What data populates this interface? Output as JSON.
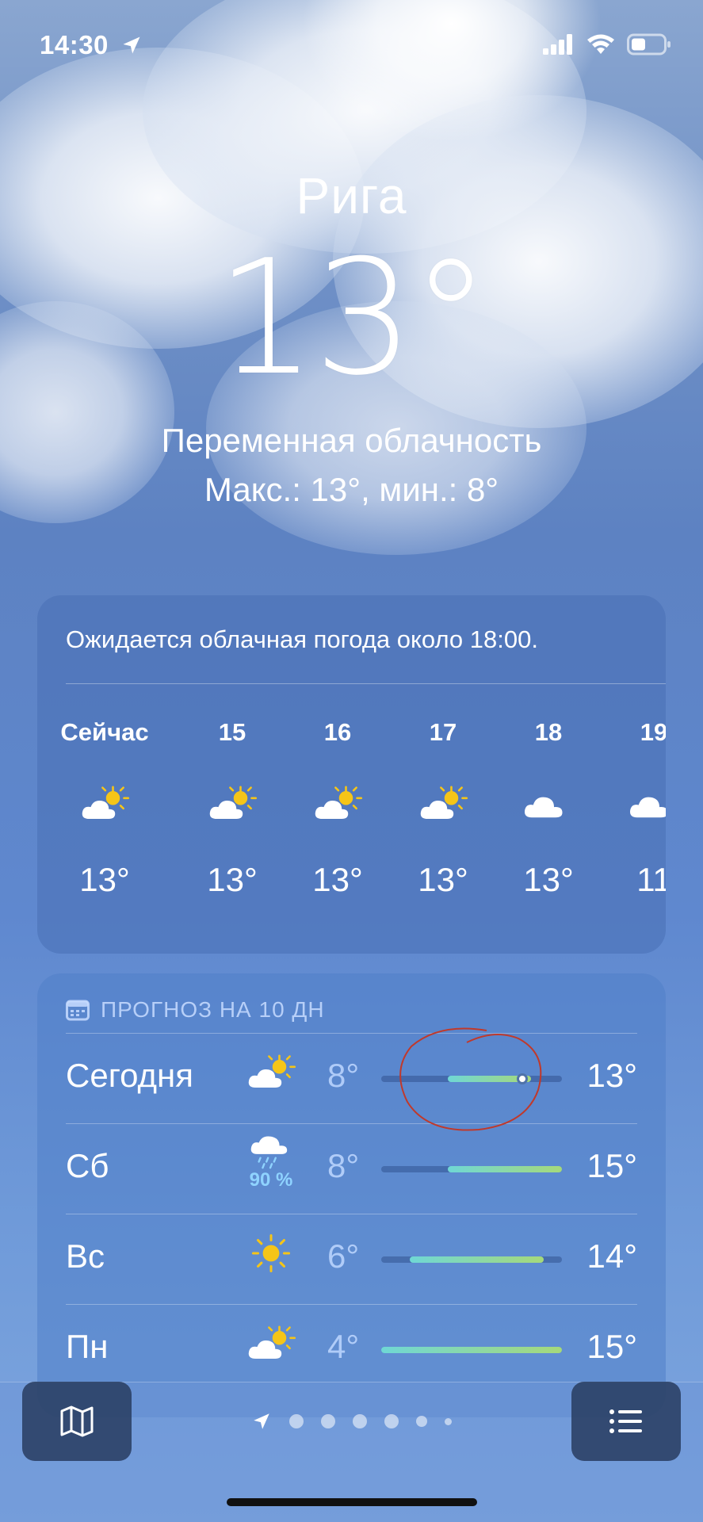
{
  "status_bar": {
    "time": "14:30",
    "icons": [
      "location-arrow-icon",
      "signal-icon",
      "wifi-icon",
      "battery-icon"
    ]
  },
  "header": {
    "city": "Рига",
    "temperature": "13°",
    "condition": "Переменная облачность",
    "hi_lo": "Макс.: 13°, мин.: 8°"
  },
  "hourly": {
    "summary": "Ожидается облачная погода около 18:00.",
    "items": [
      {
        "label": "Сейчас",
        "icon": "partly-sunny-icon",
        "temp": "13°"
      },
      {
        "label": "15",
        "icon": "partly-sunny-icon",
        "temp": "13°"
      },
      {
        "label": "16",
        "icon": "partly-sunny-icon",
        "temp": "13°"
      },
      {
        "label": "17",
        "icon": "partly-sunny-icon",
        "temp": "13°"
      },
      {
        "label": "18",
        "icon": "cloud-icon",
        "temp": "13°"
      },
      {
        "label": "19",
        "icon": "cloud-icon",
        "temp": "11"
      }
    ]
  },
  "daily": {
    "header": "ПРОГНОЗ НА 10 ДН",
    "icon": "calendar-icon",
    "items": [
      {
        "day": "Сегодня",
        "icon": "partly-sunny-icon",
        "precip": "",
        "low": "8°",
        "high": "13°",
        "bar_start": 0.37,
        "bar_end": 0.83,
        "current": 0.78
      },
      {
        "day": "Сб",
        "icon": "rain-cloud-icon",
        "precip": "90 %",
        "low": "8°",
        "high": "15°",
        "bar_start": 0.37,
        "bar_end": 1.0,
        "current": null
      },
      {
        "day": "Вс",
        "icon": "sun-icon",
        "precip": "",
        "low": "6°",
        "high": "14°",
        "bar_start": 0.16,
        "bar_end": 0.9,
        "current": null
      },
      {
        "day": "Пн",
        "icon": "partly-sunny-icon",
        "precip": "",
        "low": "4°",
        "high": "15°",
        "bar_start": 0.0,
        "bar_end": 1.0,
        "current": null
      }
    ]
  },
  "bottom_bar": {
    "map_icon": "map-icon",
    "list_icon": "list-icon",
    "location_icon": "location-arrow-icon",
    "page_count": 6
  },
  "colors": {
    "bar_gradient_start": "#6fd7d5",
    "bar_gradient_end": "#a6d97a",
    "precip": "#8fd3ff",
    "annotation": "#c0392b"
  }
}
